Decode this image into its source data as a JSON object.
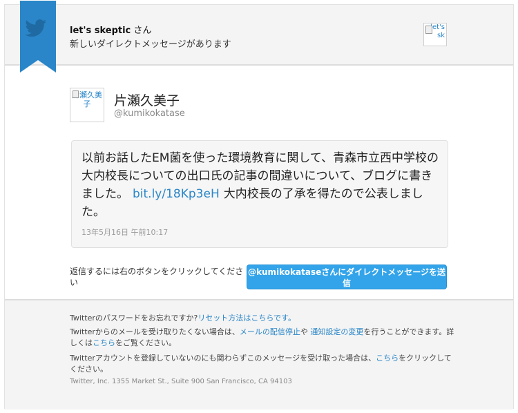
{
  "header": {
    "sender_display": "let's skeptic",
    "sender_suffix": "さん",
    "subtitle": "新しいダイレクトメッセージがあります",
    "avatar_alt": "let's sk"
  },
  "message": {
    "avatar_alt": "片瀬久美子",
    "sender_name": "片瀬久美子",
    "sender_handle": "@kumikokatase",
    "text_before": "以前お話したEM菌を使った環境教育に関して、青森市立西中学校の大内校長についての出口氏の記事の間違いについて、ブログに書きました。",
    "link": "bit.ly/18Kp3eH",
    "text_after": "大内校長の了承を得たので公表しました。",
    "timestamp": "13年5月16日 午前10:17"
  },
  "reply": {
    "label": "返信するには右のボタンをクリックしてください",
    "button": "@kumikokataseさんにダイレクトメッセージを送信"
  },
  "footer": {
    "forgot_text": "Twitterのパスワードをお忘れですか?",
    "reset_link": "リセット方法はこちらです。",
    "unsub_prefix": "Twitterからのメールを受け取りたくない場合は、",
    "unsub_link": "メールの配信停止",
    "unsub_mid": "や",
    "settings_link": "通知設定の変更",
    "unsub_suffix": "を行うことができます。詳しくは",
    "here_link_1": "こちら",
    "unsub_end": "をご覧ください。",
    "not_registered": "Twitterアカウントを登録していないのにも関わらずこのメッセージを受け取った場合は、",
    "here_link_2": "こちら",
    "not_registered_end": "をクリックしてください。",
    "address": "Twitter, Inc. 1355 Market St., Suite 900 San Francisco, CA 94103"
  },
  "colors": {
    "brand": "#2a86c8",
    "button": "#33a4ea"
  },
  "icons": {
    "ribbon": "twitter-bird-icon"
  }
}
